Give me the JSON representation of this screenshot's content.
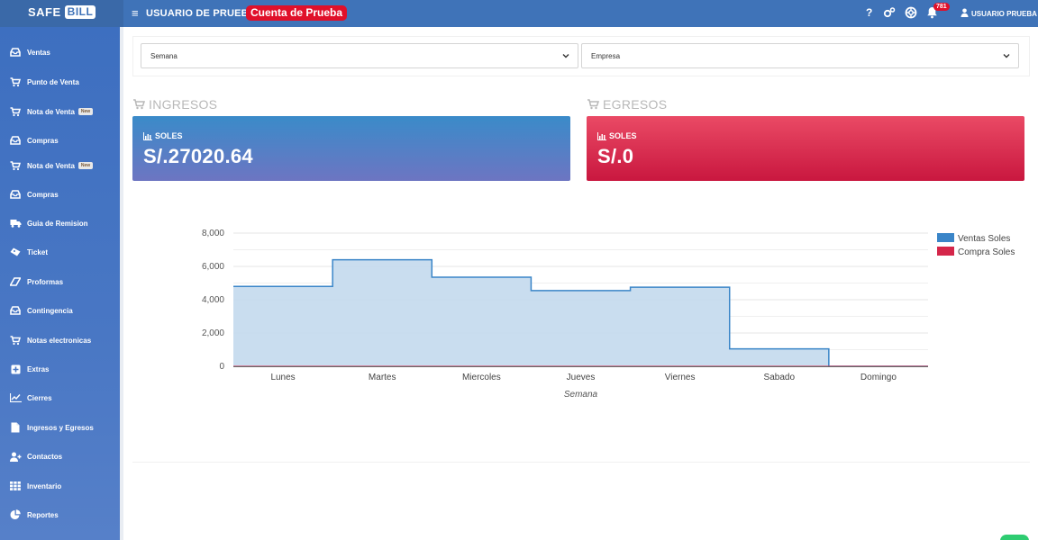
{
  "topbar": {
    "brand_a": "SAFE",
    "brand_b": "BILL",
    "menu_icon": "hamburger-icon",
    "user": "USUARIO DE PRUEBA",
    "account_badge": "Cuenta de Prueba",
    "help_label": "?",
    "notifications_count": "781",
    "user_right": "USUARIO PRUEBA",
    "color": "#3f73b8"
  },
  "sidebar": {
    "items": [
      {
        "label": "Ventas",
        "icon": "inbox-icon"
      },
      {
        "label": "Punto de Venta",
        "icon": "cart-icon"
      },
      {
        "label": "Nota de Venta",
        "icon": "cart-icon",
        "badge": "New"
      },
      {
        "label": "Compras",
        "icon": "inbox-icon"
      },
      {
        "label": "Nota de Venta",
        "icon": "cart-icon",
        "badge": "New"
      },
      {
        "label": "Compras",
        "icon": "inbox-icon"
      },
      {
        "label": "Guia de Remision",
        "icon": "truck-icon"
      },
      {
        "label": "Ticket",
        "icon": "ticket-icon"
      },
      {
        "label": "Proformas",
        "icon": "eraser-icon"
      },
      {
        "label": "Contingencia",
        "icon": "inbox-icon"
      },
      {
        "label": "Notas electronicas",
        "icon": "cart-icon"
      },
      {
        "label": "Extras",
        "icon": "plus-square-icon"
      },
      {
        "label": "Cierres",
        "icon": "line-chart-icon"
      },
      {
        "label": "Ingresos y Egresos",
        "icon": "file-icon"
      },
      {
        "label": "Contactos",
        "icon": "user-plus-icon"
      },
      {
        "label": "Inventario",
        "icon": "grid-icon"
      },
      {
        "label": "Reportes",
        "icon": "pie-chart-icon"
      }
    ]
  },
  "filters": {
    "period": "Semana",
    "company": "Empresa"
  },
  "ingresos": {
    "title": "INGRESOS",
    "label": "SOLES",
    "value": "S/.27020.64",
    "color_start": "#3a8bc9",
    "color_end": "#6d75c2"
  },
  "egresos": {
    "title": "EGRESOS",
    "label": "SOLES",
    "value": "S/.0",
    "color_start": "#ea4a65",
    "color_end": "#c9173f"
  },
  "chart_data": {
    "type": "area",
    "step": true,
    "categories": [
      "Lunes",
      "Martes",
      "Miercoles",
      "Jueves",
      "Viernes",
      "Sabado",
      "Domingo"
    ],
    "series": [
      {
        "name": "Ventas Soles",
        "color": "#3a85c8",
        "fill": "#c6dbee",
        "values": [
          4800,
          6400,
          5350,
          4550,
          4750,
          1050,
          0
        ]
      },
      {
        "name": "Compra Soles",
        "color": "#d4264a",
        "values": [
          0,
          0,
          0,
          0,
          0,
          0,
          0
        ]
      }
    ],
    "xlabel": "Semana",
    "ylabel": "",
    "ylim": [
      0,
      8000
    ],
    "yticks": [
      0,
      2000,
      4000,
      6000,
      8000
    ],
    "ytick_labels": [
      "0",
      "2,000",
      "4,000",
      "6,000",
      "8,000"
    ],
    "grid": true,
    "legend": "right"
  }
}
